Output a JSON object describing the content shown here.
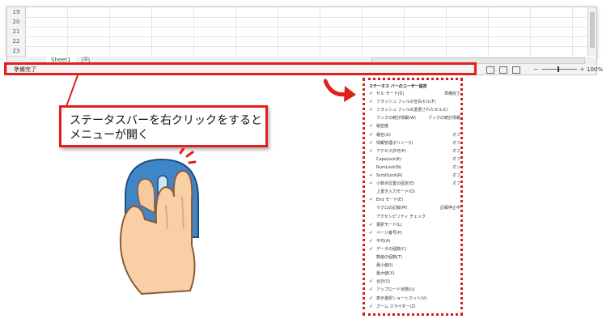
{
  "sheet": {
    "rows": [
      "19",
      "20",
      "21",
      "22",
      "23"
    ],
    "tab_label": "Sheet1",
    "add_tab": "+"
  },
  "statusbar": {
    "status_text": "準備完了",
    "zoom_minus": "−",
    "zoom_plus": "+",
    "zoom_level": "100%"
  },
  "callout": {
    "line1": "ステータスバーを右クリックをすると",
    "line2": "メニューが開く"
  },
  "menu": {
    "title": "ステータス バーのユーザー設定",
    "items": [
      {
        "check": "✓",
        "label": "セル モード(D)",
        "value": "準備完了"
      },
      {
        "check": "✓",
        "label": "フラッシュ フィルの空白セル(F)",
        "value": ""
      },
      {
        "check": "✓",
        "label": "フラッシュ フィルの変更されたセル(C)",
        "value": ""
      },
      {
        "check": "",
        "label": "ブックの統計情報(W)",
        "value": "ブックの統計情報"
      },
      {
        "check": "✓",
        "label": "秘密度",
        "value": ""
      },
      {
        "check": "✓",
        "label": "署名(G)",
        "value": "オフ"
      },
      {
        "check": "✓",
        "label": "情報管理ポリシー(I)",
        "value": "オフ"
      },
      {
        "check": "✓",
        "label": "アクセス許可(P)",
        "value": "オフ"
      },
      {
        "check": "",
        "label": "CapsLock(K)",
        "value": "オフ"
      },
      {
        "check": "",
        "label": "NumLock(N)",
        "value": "オン"
      },
      {
        "check": "✓",
        "label": "ScrollLock(R)",
        "value": "オフ"
      },
      {
        "check": "✓",
        "label": "小数点位置の固定(E)",
        "value": "オフ"
      },
      {
        "check": "",
        "label": "上書き入力モード(O)",
        "value": ""
      },
      {
        "check": "✓",
        "label": "End モード(E)",
        "value": ""
      },
      {
        "check": "",
        "label": "マクロの記録(M)",
        "value": "記録停止中"
      },
      {
        "check": "",
        "label": "アクセシビリティ チェック",
        "value": ""
      },
      {
        "check": "✓",
        "label": "選択モード(L)",
        "value": ""
      },
      {
        "check": "✓",
        "label": "ページ番号(P)",
        "value": ""
      },
      {
        "check": "✓",
        "label": "平均(A)",
        "value": ""
      },
      {
        "check": "✓",
        "label": "データの個数(C)",
        "value": ""
      },
      {
        "check": "",
        "label": "数値の個数(T)",
        "value": ""
      },
      {
        "check": "",
        "label": "最小値(I)",
        "value": ""
      },
      {
        "check": "",
        "label": "最大値(X)",
        "value": ""
      },
      {
        "check": "✓",
        "label": "合計(S)",
        "value": ""
      },
      {
        "check": "✓",
        "label": "アップロード状態(U)",
        "value": ""
      },
      {
        "check": "✓",
        "label": "表示選択ショートカット(V)",
        "value": ""
      },
      {
        "check": "✓",
        "label": "ズーム スライダー(Z)",
        "value": ""
      }
    ]
  },
  "colors": {
    "highlight": "#e0201c",
    "tab_accent": "#217346"
  }
}
